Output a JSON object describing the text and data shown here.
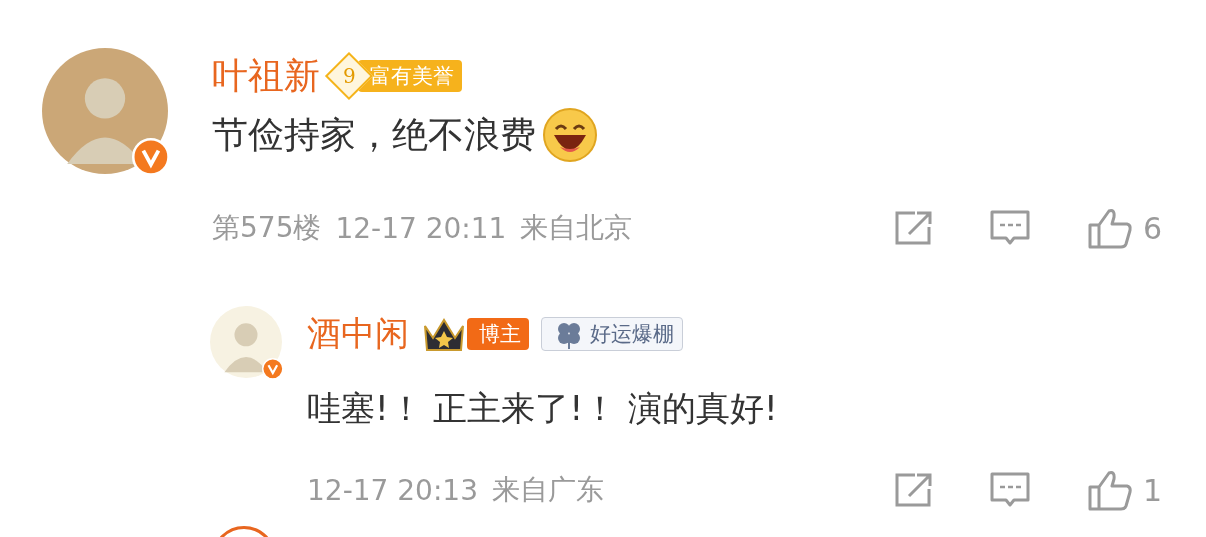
{
  "comments": [
    {
      "author": "叶祖新",
      "verified": true,
      "badges": [
        {
          "kind": "level",
          "number": "9",
          "label": "富有美誉"
        }
      ],
      "text": "节俭持家，绝不浪费",
      "emoji": true,
      "floor": "第575楼",
      "time": "12-17 20:11",
      "location": "来自北京",
      "likes": "6",
      "replies": [
        {
          "author": "酒中闲",
          "verified": true,
          "badges": [
            {
              "kind": "blogger",
              "label": "博主"
            },
            {
              "kind": "fan",
              "label": "好运爆棚"
            }
          ],
          "text": "哇塞!！ 正主来了!！ 演的真好!",
          "emoji": false,
          "time": "12-17 20:13",
          "location": "来自广东",
          "likes": "1"
        }
      ]
    }
  ],
  "next_comment": {
    "visible": true
  }
}
